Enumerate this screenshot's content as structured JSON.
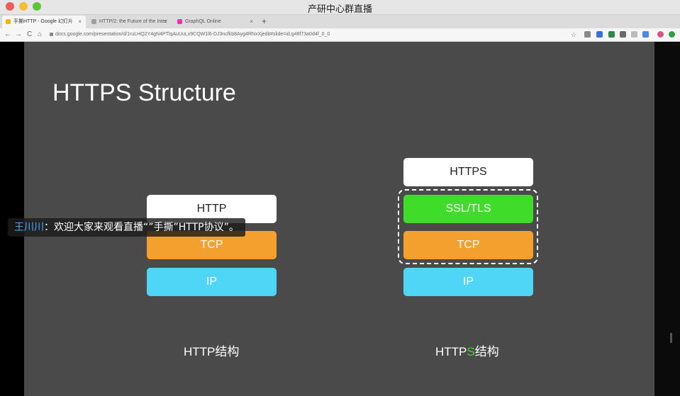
{
  "window": {
    "title": "产研中心群直播"
  },
  "tabs": [
    {
      "label": "手撕HTTP - Google 幻灯片",
      "active": true,
      "favicon_color": "#f4b400"
    },
    {
      "label": "HTTP/2: the Future of the Inter",
      "active": false,
      "favicon_color": "#9e9e9e"
    },
    {
      "label": "GraphQL Online",
      "active": false,
      "favicon_color": "#e535ab"
    }
  ],
  "tab_close": "×",
  "new_tab": "+",
  "nav": {
    "back": "←",
    "forward": "→",
    "reload": "C",
    "home": "⌂"
  },
  "address": {
    "url": "docs.google.com/presentation/d/1ruLHQ2Y4gN4PTlqAuUuLx9CQW1l6-DJ3ncfkb8Ayg4RNxXjedit#slide=id.g48f73a0d4f_0_0"
  },
  "slide": {
    "title": "HTTPS Structure",
    "http_stack": [
      "HTTP",
      "TCP",
      "IP"
    ],
    "https_stack": [
      "HTTPS",
      "SSL/TLS",
      "TCP",
      "IP"
    ],
    "http_label": "HTTP结构",
    "https_label_prefix": "HTTP",
    "https_label_highlight": "S",
    "https_label_suffix": "结构"
  },
  "comment": {
    "user": "王川川",
    "separator": "：",
    "text": "欢迎大家来观看直播“”手撕”HTTP协议”。"
  },
  "colors": {
    "tcp": "#f4a02f",
    "ip": "#4fd5f6",
    "ssl": "#3fdc2a",
    "slide_bg": "#4a4a4a"
  }
}
